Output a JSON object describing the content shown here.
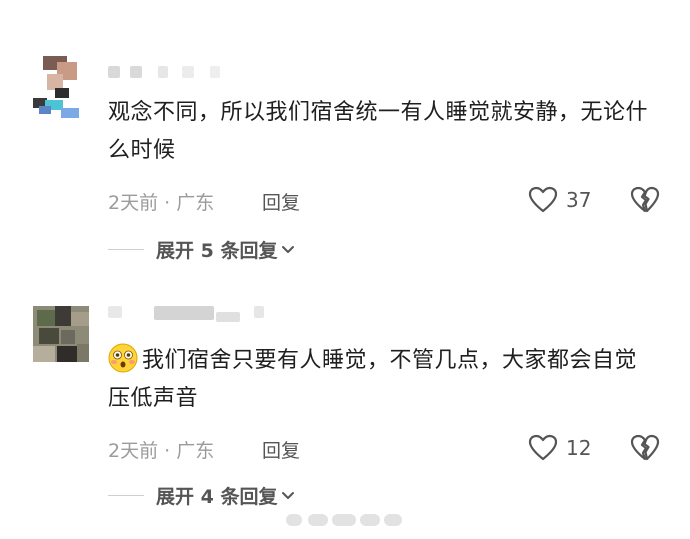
{
  "comments": [
    {
      "text": "观念不同，所以我们宿舍统一有人睡觉就安静，无论什么时候",
      "meta": "2天前 · 广东",
      "reply_label": "回复",
      "likes": "37",
      "expand_label": "展开 5 条回复",
      "avatar_colors": [
        "#6b4f45",
        "#c99b86",
        "#4ec3d6",
        "#3a3a3a"
      ]
    },
    {
      "emoji": "flushed-emoji",
      "text": "我们宿舍只要有人睡觉，不管几点，大家都会自觉压低声音",
      "meta": "2天前 · 广东",
      "reply_label": "回复",
      "likes": "12",
      "expand_label": "展开 4 条回复",
      "avatar_colors": [
        "#5d6b4a",
        "#3e3a36",
        "#8c8a7a",
        "#a59c8a"
      ]
    }
  ],
  "icons": {
    "like": "heart-outline-icon",
    "dislike": "broken-heart-icon",
    "expand": "chevron-down-icon"
  },
  "colors": {
    "text": "#1f1f1f",
    "meta": "#9b9b9b",
    "action": "#555555"
  }
}
